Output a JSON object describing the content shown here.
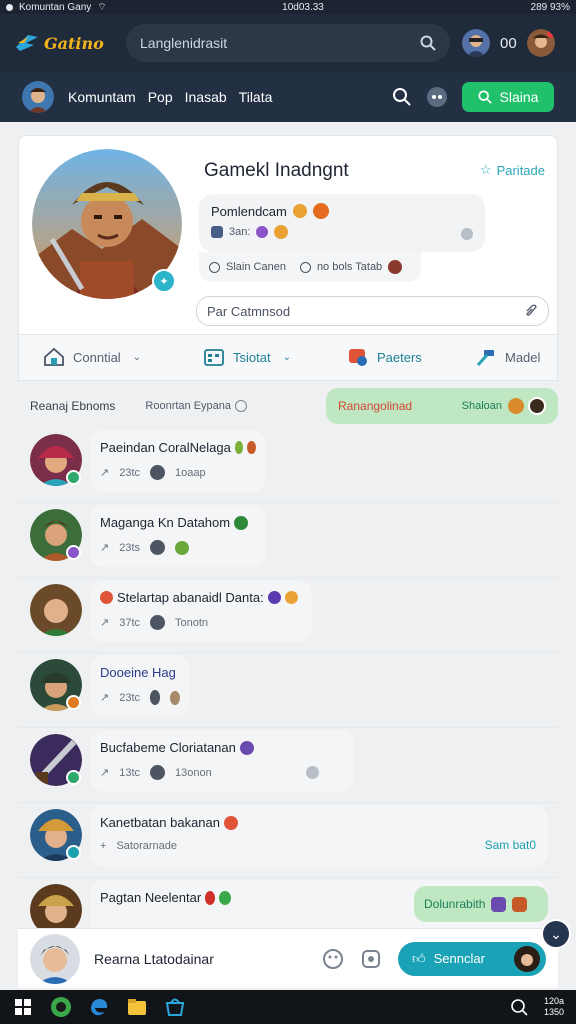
{
  "status_bar": {
    "left_text": "Komuntan Gany",
    "center_text": "10d03.33",
    "right_text": "289 93%"
  },
  "header": {
    "logo_text": "Gatino",
    "search_placeholder": "Langlenidrasit",
    "count_text": "00",
    "brand_color": "#f3b31b"
  },
  "nav": {
    "links": [
      "Komuntam",
      "Pop",
      "Inasab",
      "Tilata"
    ],
    "action_label": "Slaina",
    "action_color": "#21c06b"
  },
  "profile": {
    "title": "Gamekl Inadngnt",
    "action_label": "Paritade",
    "bubble_line1": "Pomlendcam",
    "bubble_line2": "3an:",
    "meta_left": "Slain Canen",
    "meta_right": "no bols Tatab",
    "input_placeholder": "Par Catmnsod"
  },
  "tabs": [
    {
      "label": "Conntial",
      "icon": "house-icon",
      "active": false
    },
    {
      "label": "Tsiotat",
      "icon": "calendar-icon",
      "active": true
    },
    {
      "label": "Paeters",
      "icon": "badge-icon",
      "active": false
    },
    {
      "label": "Madel",
      "icon": "hammer-icon",
      "active": false
    }
  ],
  "filters": {
    "label": "Reanaj Ebnoms",
    "secondary": "Roonrtan Eypana",
    "pill_title": "Ranangolinad",
    "pill_subtitle": "Shaloan"
  },
  "feed": [
    {
      "title": "Paeindan CoralNelaga",
      "meta1": "23tc",
      "meta2": "1oaap",
      "badge_color": "#2ea86a",
      "colors": [
        "#7a2e4a",
        "#2aa3b8"
      ]
    },
    {
      "title": "Maganga Kn Datahom",
      "meta1": "23ts",
      "meta2": "",
      "badge_color": "#8a55c8",
      "colors": [
        "#3b6e3a",
        "#b05a2c"
      ]
    },
    {
      "title": "Stelartap abanaidl Danta:",
      "meta1": "37tc",
      "meta2": "Tonotn",
      "badge_color": "",
      "colors": [
        "#6b4a2a",
        "#2f7a38"
      ]
    },
    {
      "title": "Dooeine Hag",
      "meta1": "23tc",
      "meta2": "",
      "badge_color": "#e07a22",
      "colors": [
        "#2c4a3a",
        "#c99a5a"
      ]
    },
    {
      "title": "Bucfabeme Cloriatanan",
      "meta1": "13tc",
      "meta2": "13onon",
      "badge_color": "#2ea86a",
      "colors": [
        "#3b2a5c",
        "#8c8c8c"
      ]
    },
    {
      "title": "Kanetbatan bakanan",
      "meta1": "Satorarnade",
      "meta2": "",
      "badge_color": "#1da0ae",
      "colors": [
        "#2b5e8a",
        "#d49a3a"
      ],
      "side_text": "Sam bat0"
    },
    {
      "title": "Pagtan Neelentar",
      "meta1": "",
      "meta2": "",
      "badge_color": "",
      "colors": [
        "#5c3a1e",
        "#caa24a"
      ],
      "side_pill": "Dolunrabith"
    }
  ],
  "composer": {
    "name": "Rearna Ltatodainar",
    "button_label": "Sennclar",
    "button_color": "#1aa2b6"
  },
  "taskbar": {
    "clock_line1": "120a",
    "clock_line2": "1350"
  }
}
